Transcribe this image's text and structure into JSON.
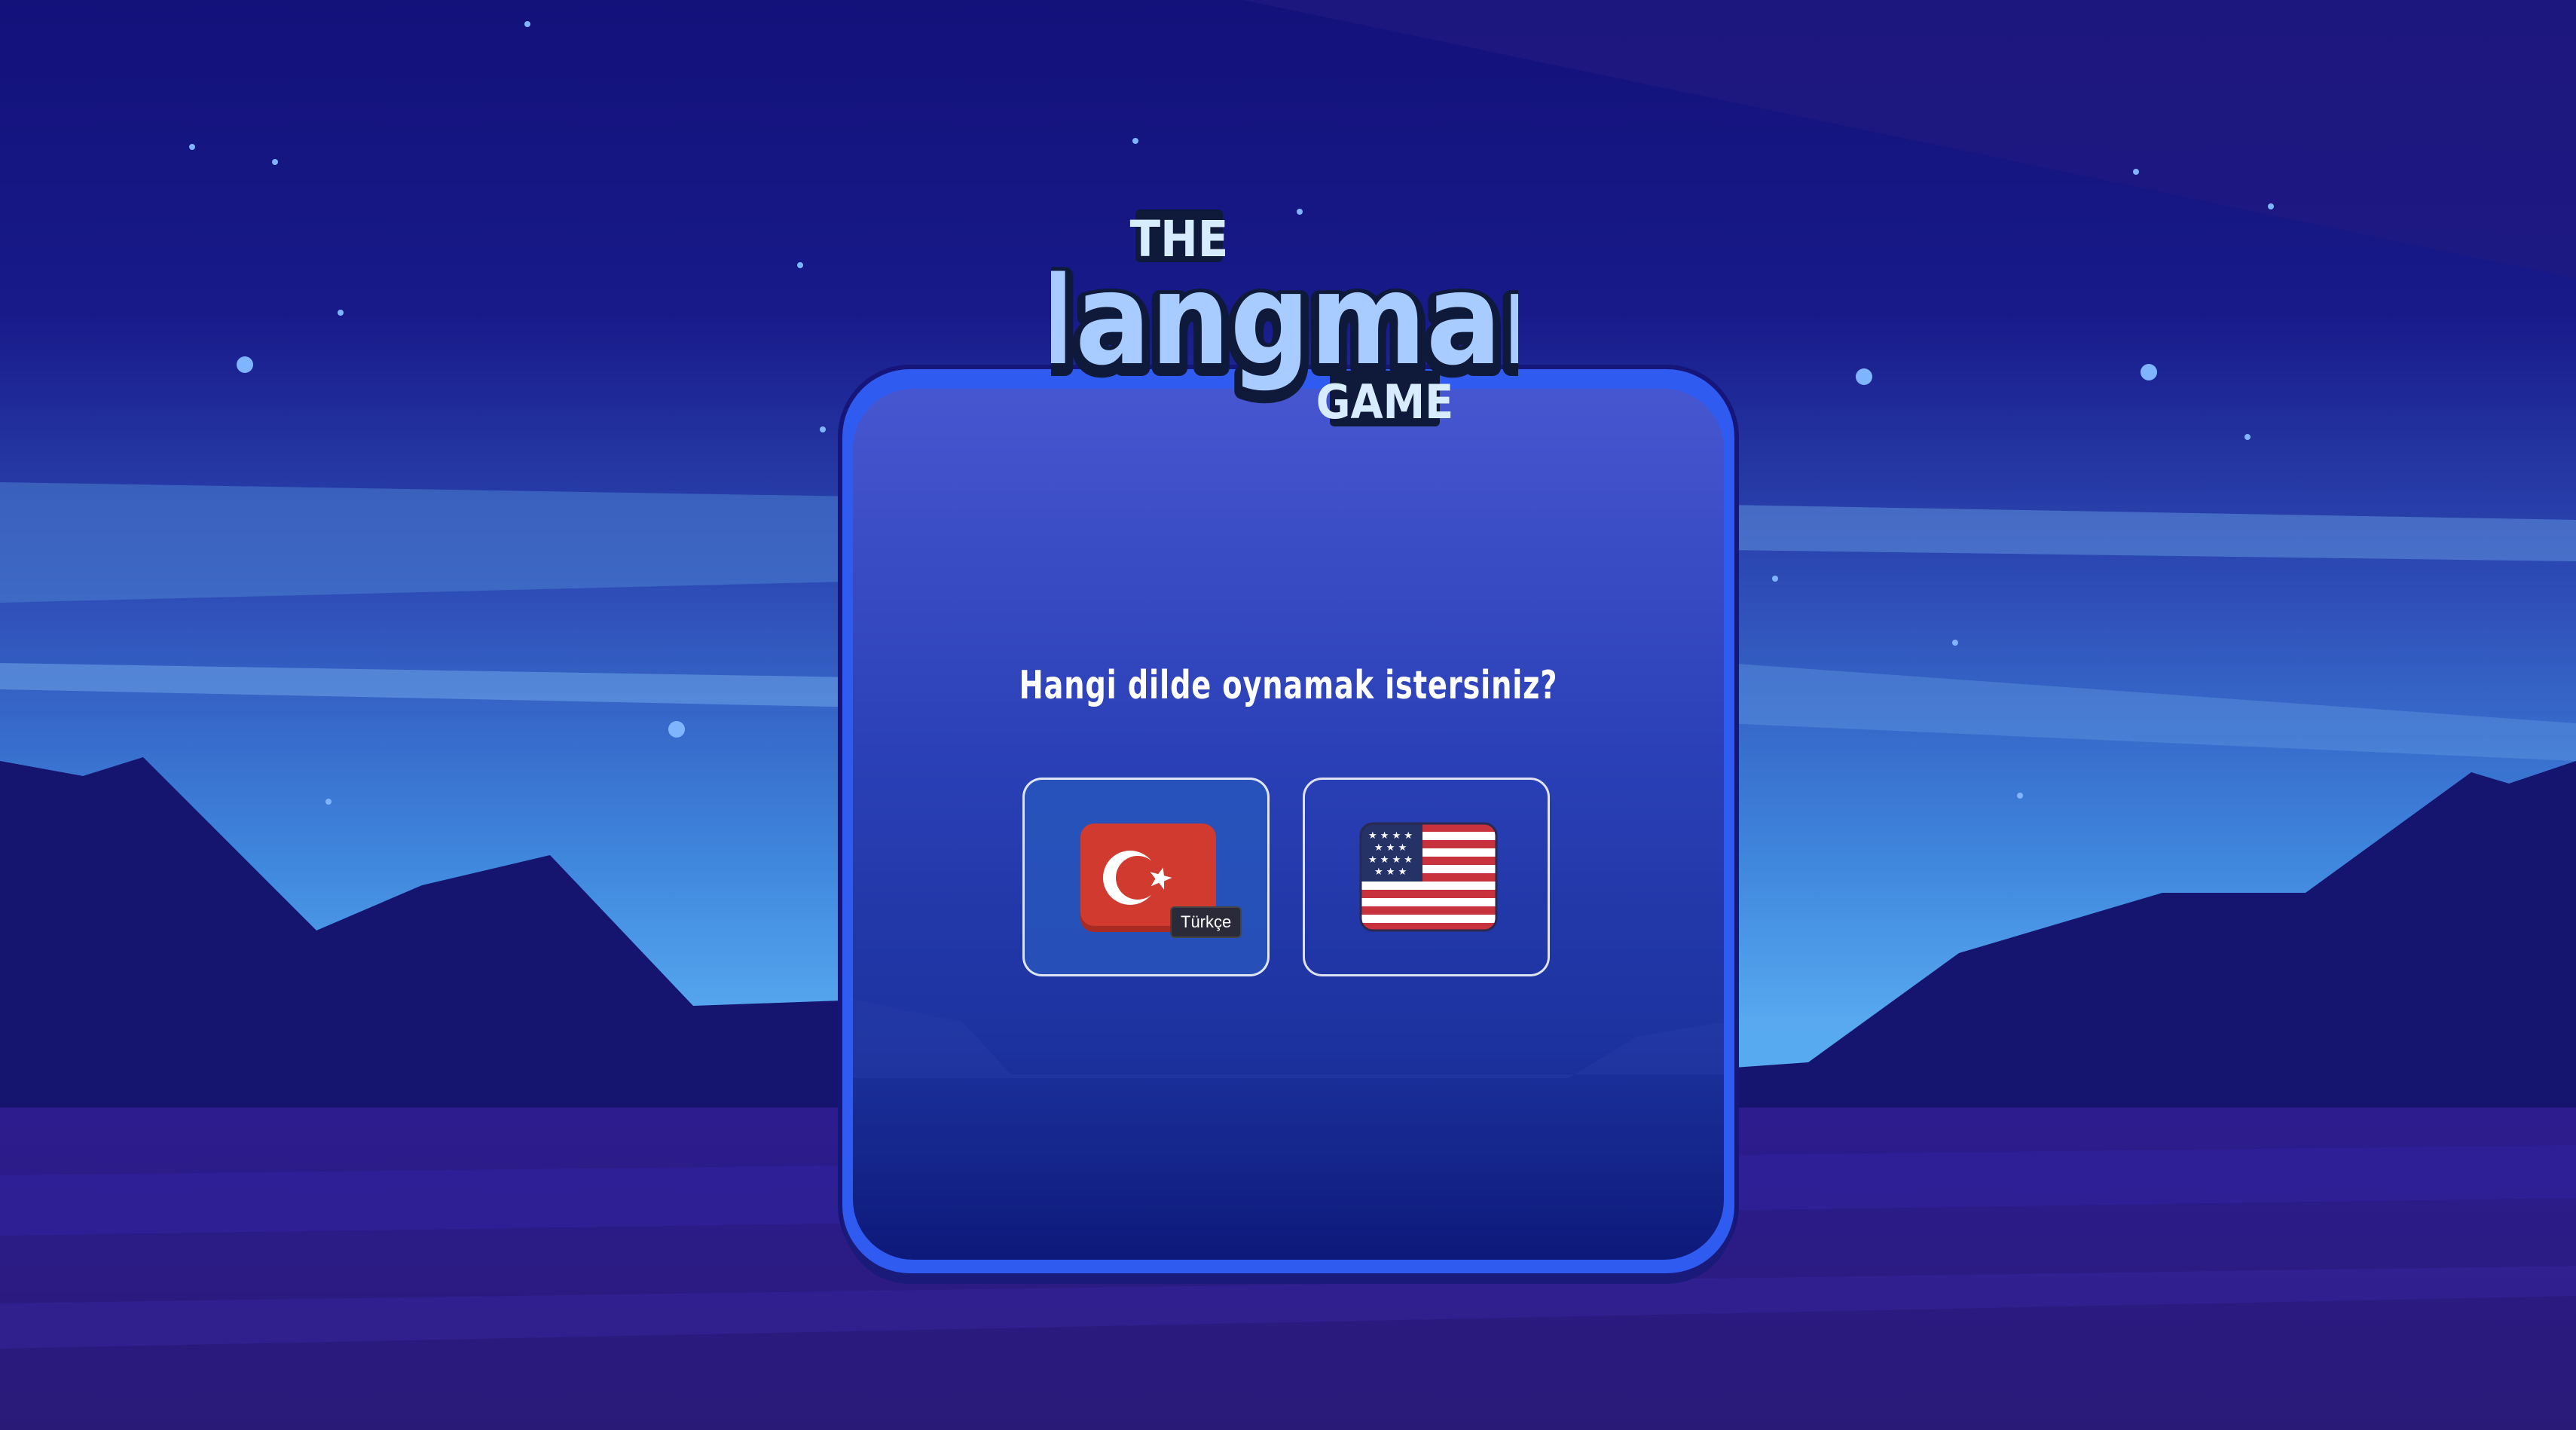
{
  "logo": {
    "the": "THE",
    "title": "Hangman",
    "game": "GAME"
  },
  "question": "Hangi dilde oynamak istersiniz?",
  "languages": [
    {
      "id": "tr",
      "tooltip": "Türkçe",
      "flag": "turkey-flag-icon"
    },
    {
      "id": "en",
      "flag": "usa-flag-icon"
    }
  ],
  "colors": {
    "sky_top": "#13117a",
    "mountains": "#15146e",
    "ground": "#2d1e8f",
    "panel_border": "#2f5bf0",
    "logo_text": "#a8ccff",
    "turkey_red": "#d03a2f",
    "usa_red": "#c8323c",
    "usa_blue": "#243266"
  }
}
